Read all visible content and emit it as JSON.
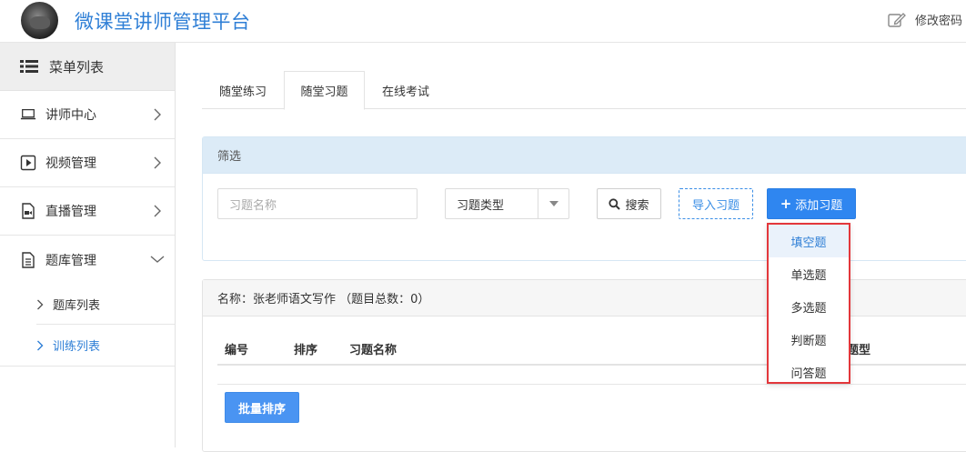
{
  "header": {
    "title": "微课堂讲师管理平台",
    "change_password": "修改密码"
  },
  "sidebar": {
    "menu_title": "菜单列表",
    "items": [
      {
        "label": "讲师中心",
        "icon": "laptop-icon"
      },
      {
        "label": "视频管理",
        "icon": "play-icon"
      },
      {
        "label": "直播管理",
        "icon": "live-icon"
      },
      {
        "label": "题库管理",
        "icon": "document-icon"
      }
    ],
    "sub_items": [
      {
        "label": "题库列表"
      },
      {
        "label": "训练列表"
      }
    ]
  },
  "tabs": [
    {
      "label": "随堂练习"
    },
    {
      "label": "随堂习题"
    },
    {
      "label": "在线考试"
    }
  ],
  "filter": {
    "title": "筛选",
    "name_placeholder": "习题名称",
    "type_selected": "习题类型",
    "search_label": "搜索",
    "import_label": "导入习题",
    "add_label": "添加习题"
  },
  "list": {
    "title": "名称：张老师语文写作 （题目总数：0）",
    "columns": [
      "编号",
      "排序",
      "习题名称",
      "题型"
    ],
    "batch_sort_label": "批量排序"
  },
  "dropdown": {
    "items": [
      "填空题",
      "单选题",
      "多选题",
      "判断题",
      "问答题"
    ]
  },
  "colors": {
    "accent": "#2f7fd6",
    "primary_button": "#2f86f0",
    "highlight_border": "#e3373b"
  }
}
